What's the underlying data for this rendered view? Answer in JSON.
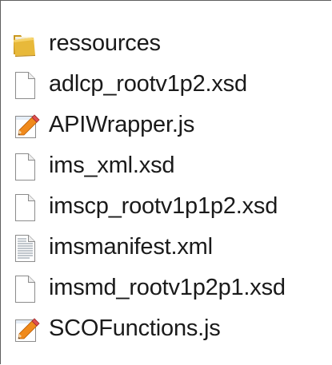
{
  "files": [
    {
      "name": "ressources",
      "icon": "folder-icon"
    },
    {
      "name": "adlcp_rootv1p2.xsd",
      "icon": "blank-file-icon"
    },
    {
      "name": "APIWrapper.js",
      "icon": "script-file-icon"
    },
    {
      "name": "ims_xml.xsd",
      "icon": "blank-file-icon"
    },
    {
      "name": "imscp_rootv1p1p2.xsd",
      "icon": "blank-file-icon"
    },
    {
      "name": "imsmanifest.xml",
      "icon": "text-file-icon"
    },
    {
      "name": "imsmd_rootv1p2p1.xsd",
      "icon": "blank-file-icon"
    },
    {
      "name": "SCOFunctions.js",
      "icon": "script-file-icon"
    }
  ]
}
